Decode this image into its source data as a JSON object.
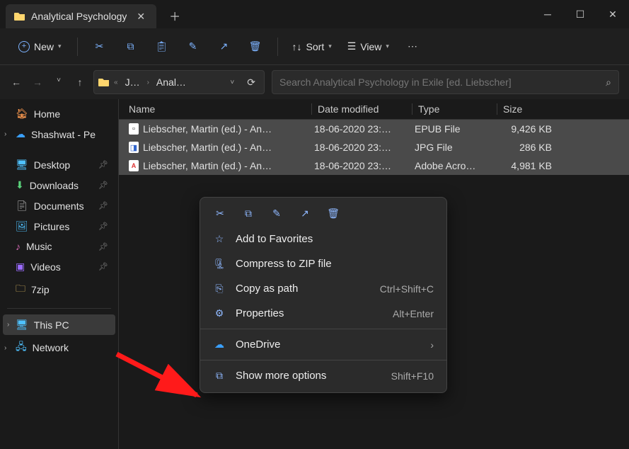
{
  "tab": {
    "title": "Analytical Psychology"
  },
  "toolbar": {
    "new_label": "New",
    "sort_label": "Sort",
    "view_label": "View"
  },
  "breadcrumbs": {
    "first": "J…",
    "second": "Anal…"
  },
  "search": {
    "placeholder": "Search Analytical Psychology in Exile [ed. Liebscher]"
  },
  "columns": {
    "name": "Name",
    "date": "Date modified",
    "type": "Type",
    "size": "Size"
  },
  "sidebar": {
    "home": "Home",
    "onedrive": "Shashwat - Pe",
    "desktop": "Desktop",
    "downloads": "Downloads",
    "documents": "Documents",
    "pictures": "Pictures",
    "music": "Music",
    "videos": "Videos",
    "sevenzip": "7zip",
    "thispc": "This PC",
    "network": "Network"
  },
  "files": [
    {
      "name": "Liebscher, Martin (ed.) - An…",
      "date": "18-06-2020 23:…",
      "type": "EPUB File",
      "size": "9,426 KB",
      "icon": "epub"
    },
    {
      "name": "Liebscher, Martin (ed.) - An…",
      "date": "18-06-2020 23:…",
      "type": "JPG File",
      "size": "286 KB",
      "icon": "jpg"
    },
    {
      "name": "Liebscher, Martin (ed.) - An…",
      "date": "18-06-2020 23:…",
      "type": "Adobe Acro…",
      "size": "4,981 KB",
      "icon": "pdf"
    }
  ],
  "ctx": {
    "favorites": "Add to Favorites",
    "compress": "Compress to ZIP file",
    "copypath": "Copy as path",
    "copypath_sc": "Ctrl+Shift+C",
    "properties": "Properties",
    "properties_sc": "Alt+Enter",
    "onedrive": "OneDrive",
    "more": "Show more options",
    "more_sc": "Shift+F10"
  }
}
